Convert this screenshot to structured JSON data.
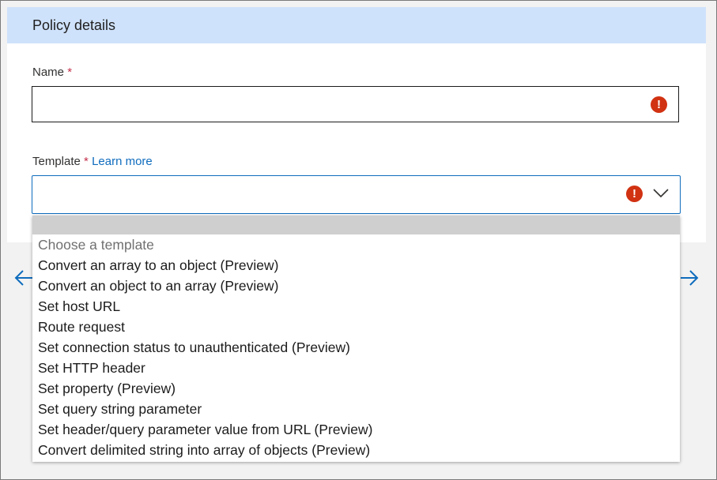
{
  "panel": {
    "title": "Policy details"
  },
  "name_field": {
    "label": "Name",
    "required_mark": "*",
    "value": ""
  },
  "template_field": {
    "label": "Template",
    "required_mark": "*",
    "learn_more": "Learn more",
    "value": ""
  },
  "icons": {
    "error": "exclamation-error-icon",
    "chevron": "chevron-down-icon",
    "nav_left": "arrow-left-icon",
    "nav_right": "arrow-right-icon"
  },
  "colors": {
    "header_bg": "#cfe2fb",
    "error": "#d13212",
    "link": "#0f6cbd",
    "required": "#c4314b"
  },
  "dropdown": {
    "placeholder": "Choose a template",
    "options": [
      "Convert an array to an object (Preview)",
      "Convert an object to an array (Preview)",
      "Set host URL",
      "Route request",
      "Set connection status to unauthenticated (Preview)",
      "Set HTTP header",
      "Set property (Preview)",
      "Set query string parameter",
      "Set header/query parameter value from URL (Preview)",
      "Convert delimited string into array of objects (Preview)"
    ]
  }
}
